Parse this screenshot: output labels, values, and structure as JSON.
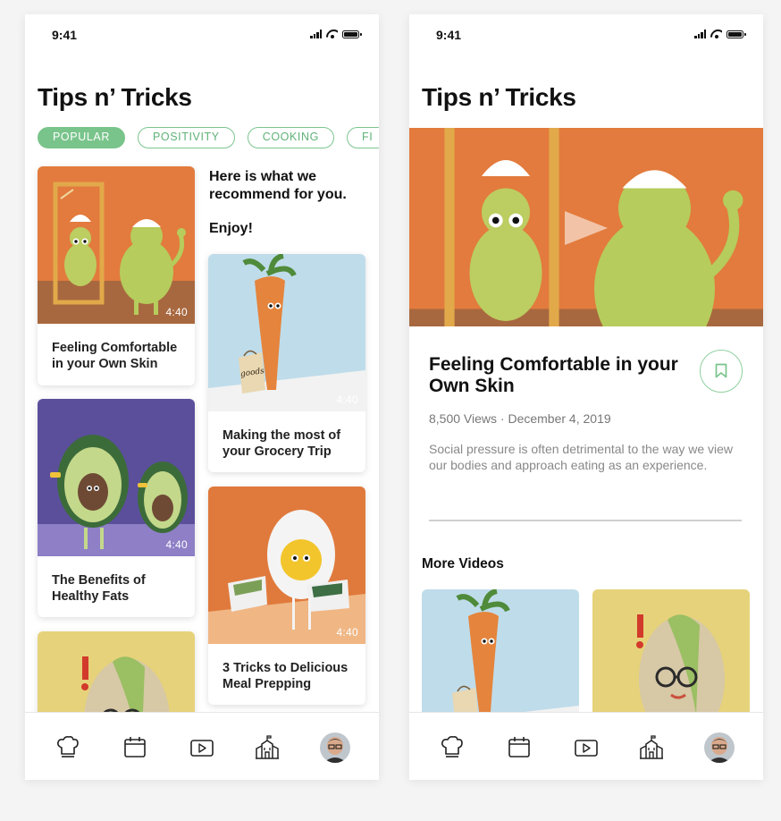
{
  "status": {
    "time": "9:41"
  },
  "header": {
    "title": "Tips n’ Tricks"
  },
  "filters": [
    "POPULAR",
    "POSITIVITY",
    "COOKING",
    "FI"
  ],
  "recommendation": {
    "line1": "Here is what we recommend for you.",
    "line2": "Enjoy!"
  },
  "videos": [
    {
      "title": "Feeling Comfortable in your Own Skin",
      "duration": "4:40"
    },
    {
      "title": "Making the most of your Grocery Trip",
      "duration": "4:40"
    },
    {
      "title": "The Benefits of Healthy Fats",
      "duration": "4:40"
    },
    {
      "title": "3 Tricks to Delicious Meal Prepping",
      "duration": "4:40"
    }
  ],
  "bag_text": "goods",
  "detail": {
    "title": "Feeling Comfortable in your Own Skin",
    "meta": "8,500 Views · December 4, 2019",
    "description": "Social pressure is often detrimental to the way we view our bodies and approach eating as an experience.",
    "more_videos": "More Videos"
  },
  "tabbar": [
    "chef-hat-icon",
    "calendar-icon",
    "video-icon",
    "school-icon",
    "avatar"
  ],
  "colors": {
    "accent_green": "#79c48b",
    "orange_bg": "#e07a3c",
    "blue_bg": "#bfdcea",
    "purple_bg": "#5b4f9c",
    "yellow_bg": "#e6d27a"
  }
}
